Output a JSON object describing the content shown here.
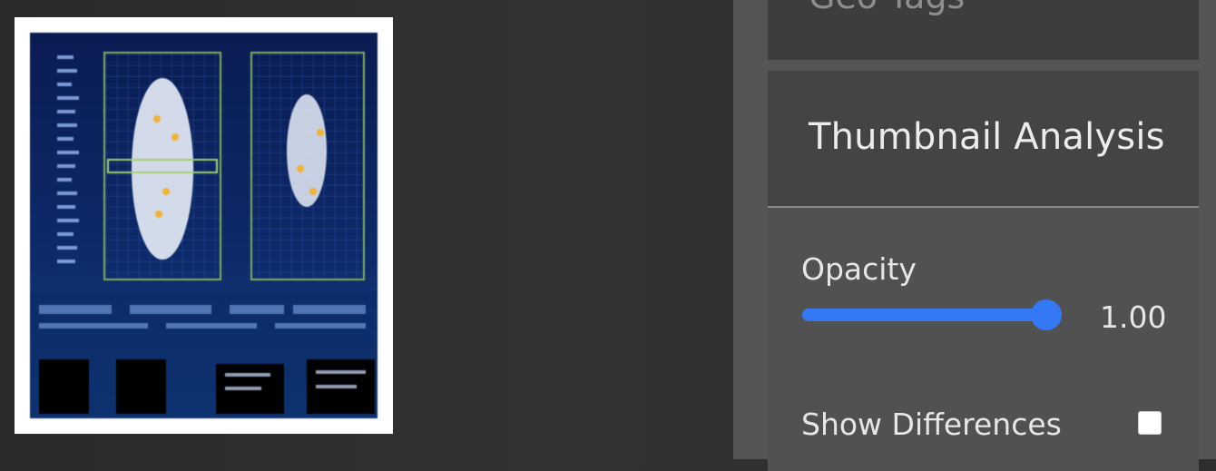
{
  "thumbnail": {
    "alt": "thumbnail image"
  },
  "panel": {
    "geo_tags": {
      "title": "Geo Tags"
    },
    "thumbnail_analysis": {
      "title": "Thumbnail Analysis",
      "opacity": {
        "label": "Opacity",
        "value": 1.0,
        "value_text": "1.00"
      },
      "show_differences": {
        "label": "Show Differences",
        "checked": false
      }
    }
  },
  "colors": {
    "accent": "#3478f6",
    "panel_bg": "#515151",
    "header_bg": "#444444",
    "page_bg": "#303030"
  }
}
